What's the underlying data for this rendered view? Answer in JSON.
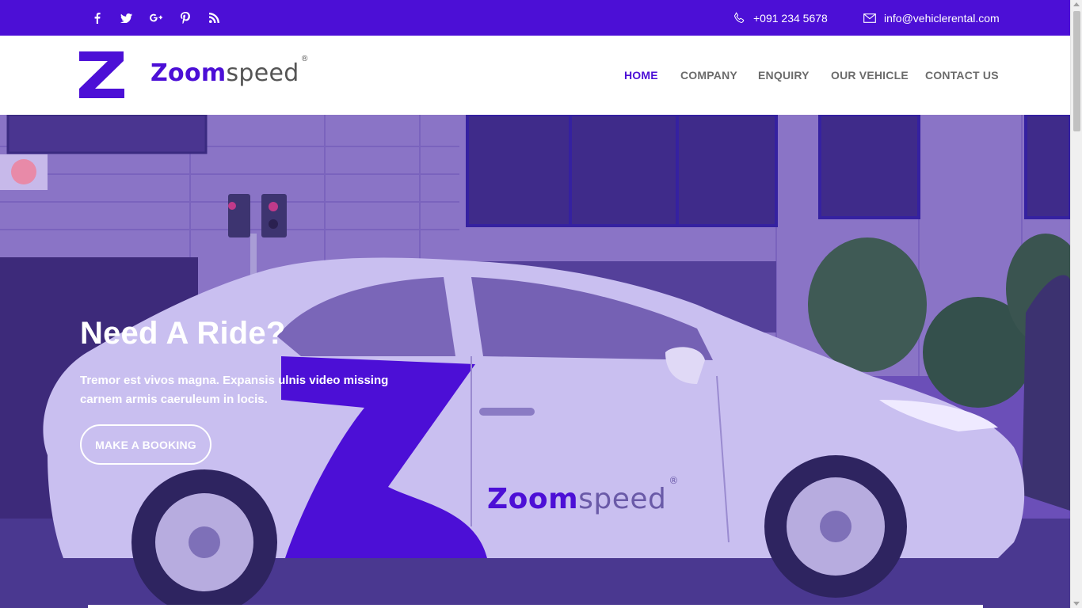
{
  "topbar": {
    "social_icons": [
      "facebook-icon",
      "twitter-icon",
      "google-plus-icon",
      "pinterest-icon",
      "rss-icon"
    ],
    "phone": "+091 234 5678",
    "email": "info@vehiclerental.com"
  },
  "header": {
    "brand_bold": "Zoom",
    "brand_light": "speed",
    "brand_mark": "®",
    "nav": {
      "home": "HOME",
      "company": "COMPANY",
      "enquiry": "ENQUIRY",
      "vehicle": "OUR VEHICLE",
      "contact": "CONTACT US"
    }
  },
  "hero": {
    "title": "Need A Ride?",
    "text": "Tremor est vivos magna. Expansis ulnis video missing carnem armis caeruleum in locis.",
    "button": "MAKE A BOOKING",
    "car_brand_bold": "Zoom",
    "car_brand_light": "speed",
    "car_brand_mark": "®"
  },
  "colors": {
    "accent": "#4c0fd6",
    "nav_text": "#6b6b6b",
    "hero_overlay": "#6a4cc0"
  }
}
